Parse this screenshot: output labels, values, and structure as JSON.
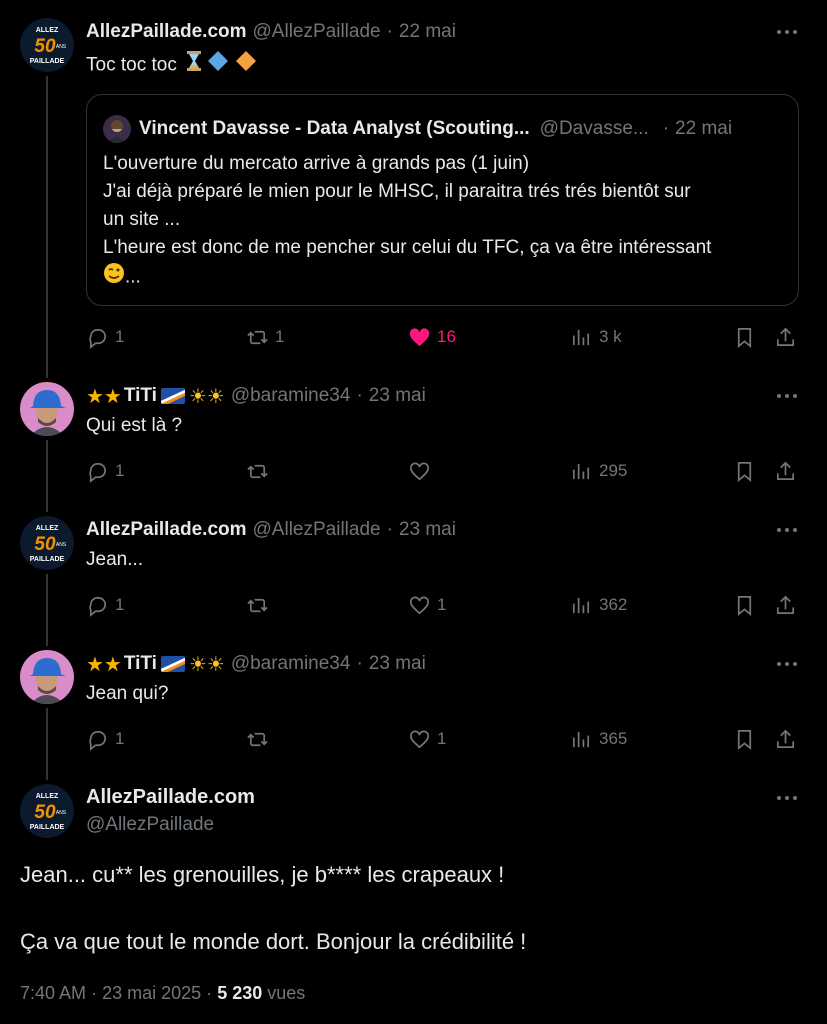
{
  "tweets": [
    {
      "name": "AllezPaillade.com",
      "handle": "@AllezPaillade",
      "sep": "·",
      "date": "22 mai",
      "text": "Toc toc toc",
      "quote": {
        "name": "Vincent Davasse - Data Analyst (Scouting...",
        "handle": "@Davasse...",
        "sep": "·",
        "date": "22 mai",
        "lines": [
          "L'ouverture du mercato arrive à grands pas (1 juin)",
          "J'ai déjà préparé le mien pour le MHSC, il paraitra trés trés bientôt sur",
          "un site ...",
          "L'heure est donc de me pencher sur celui du TFC, ça va être intéressant",
          "..."
        ]
      },
      "actions": {
        "reply": "1",
        "retweet": "1",
        "like": "16",
        "views": "3 k"
      }
    },
    {
      "name": "TiTi",
      "handle": "@baramine34",
      "sep": "·",
      "date": "23 mai",
      "text": "Qui est là ?",
      "actions": {
        "reply": "1",
        "retweet": "",
        "like": "",
        "views": "295"
      }
    },
    {
      "name": "AllezPaillade.com",
      "handle": "@AllezPaillade",
      "sep": "·",
      "date": "23 mai",
      "text": "Jean...",
      "actions": {
        "reply": "1",
        "retweet": "",
        "like": "1",
        "views": "362"
      }
    },
    {
      "name": "TiTi",
      "handle": "@baramine34",
      "sep": "·",
      "date": "23 mai",
      "text": "Jean qui?",
      "actions": {
        "reply": "1",
        "retweet": "",
        "like": "1",
        "views": "365"
      }
    }
  ],
  "main": {
    "name": "AllezPaillade.com",
    "handle": "@AllezPaillade",
    "line1": "Jean... cu** les grenouilles, je b**** les crapeaux !",
    "line2": "Ça va que tout le monde dort. Bonjour la crédibilité !",
    "time": "7:40 AM",
    "sep": "·",
    "date": "23 mai 2025",
    "sep2": "·",
    "views": "5 230",
    "views_label": "vues"
  },
  "colors": {
    "background": "#000000",
    "text": "#e7e9ea",
    "muted": "#71767b",
    "like_active": "#f91880",
    "border": "#2f3336"
  },
  "avatar_text": {
    "top": "ALLEZ",
    "mid": "50",
    "bottom": "PAILLADE",
    "sub": "ANS"
  }
}
